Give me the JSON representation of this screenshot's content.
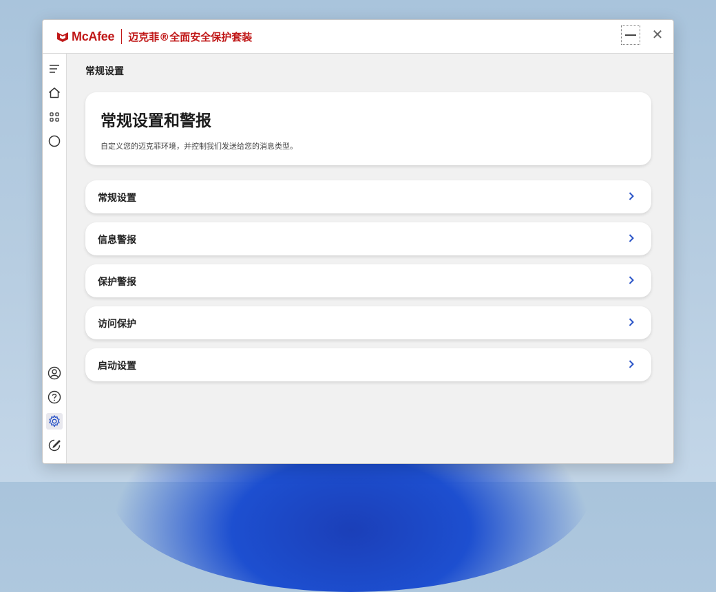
{
  "app": {
    "brand_name": "McAfee",
    "product_name": "迈克菲®全面安全保护套装",
    "accent_color": "#c01818",
    "link_color": "#2b55c8"
  },
  "window_controls": {
    "minimize_icon": "minimize-icon",
    "close_icon": "close-icon",
    "close_glyph": "✕"
  },
  "sidebar": {
    "top_items": [
      {
        "name": "menu",
        "icon": "hamburger-menu-icon"
      },
      {
        "name": "home",
        "icon": "home-icon"
      },
      {
        "name": "apps",
        "icon": "apps-grid-icon"
      },
      {
        "name": "status",
        "icon": "circle-status-icon"
      }
    ],
    "bottom_items": [
      {
        "name": "account",
        "icon": "account-icon"
      },
      {
        "name": "help",
        "icon": "help-icon"
      },
      {
        "name": "settings",
        "icon": "gear-icon",
        "active": true
      },
      {
        "name": "feedback",
        "icon": "feedback-icon"
      }
    ]
  },
  "page": {
    "breadcrumb": "常规设置",
    "hero_title": "常规设置和警报",
    "hero_subtitle": "自定义您的迈克菲环境，并控制我们发送给您的消息类型。"
  },
  "menu_items": [
    {
      "label": "常规设置"
    },
    {
      "label": "信息警报"
    },
    {
      "label": "保护警报"
    },
    {
      "label": "访问保护"
    },
    {
      "label": "启动设置"
    }
  ]
}
